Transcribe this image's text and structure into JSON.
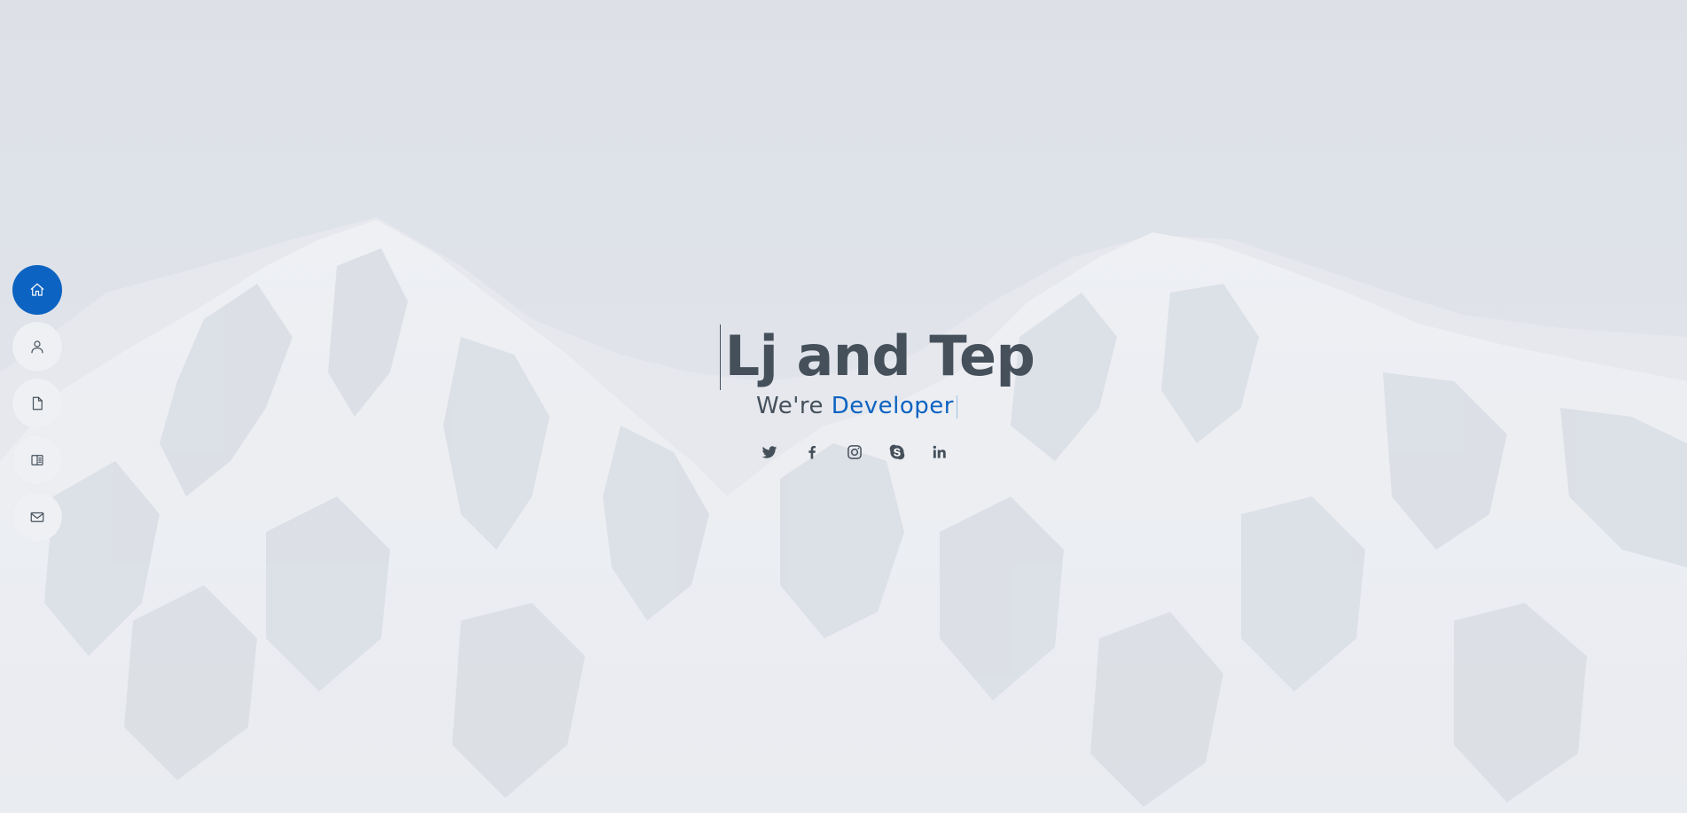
{
  "hero": {
    "title": "Lj and Tep",
    "subtitle_prefix": "We're",
    "subtitle_typed": "Developer"
  },
  "nav": {
    "items": [
      {
        "name": "nav-home",
        "icon": "home-icon",
        "active": true
      },
      {
        "name": "nav-about",
        "icon": "person-icon",
        "active": false
      },
      {
        "name": "nav-resume",
        "icon": "file-icon",
        "active": false
      },
      {
        "name": "nav-portfolio",
        "icon": "book-icon",
        "active": false
      },
      {
        "name": "nav-contact",
        "icon": "envelope-icon",
        "active": false
      }
    ]
  },
  "social": {
    "links": [
      {
        "name": "twitter-link",
        "icon": "twitter-icon"
      },
      {
        "name": "facebook-link",
        "icon": "facebook-icon"
      },
      {
        "name": "instagram-link",
        "icon": "instagram-icon"
      },
      {
        "name": "skype-link",
        "icon": "skype-icon"
      },
      {
        "name": "linkedin-link",
        "icon": "linkedin-icon"
      }
    ]
  },
  "colors": {
    "accent": "#0d63c1",
    "text": "#45505b",
    "background": "#dadee5"
  }
}
